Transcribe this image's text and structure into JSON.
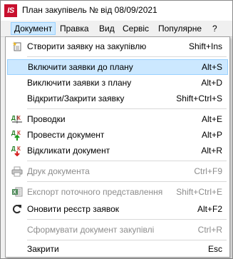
{
  "window": {
    "logo_text": "IS",
    "title": "План закупівель №  від 08/09/2021"
  },
  "menubar": [
    {
      "label": "Документ",
      "active": true
    },
    {
      "label": "Правка"
    },
    {
      "label": "Вид"
    },
    {
      "label": "Сервіс"
    },
    {
      "label": "Популярне"
    },
    {
      "label": "?"
    }
  ],
  "menu": {
    "items": [
      {
        "label": "Створити заявку на закупівлю",
        "shortcut": "Shift+Ins",
        "icon": "new-document-star-icon"
      },
      {
        "label": "Включити заявки до плану",
        "shortcut": "Alt+S",
        "icon": null,
        "highlighted": true
      },
      {
        "label": "Виключити заявки з плану",
        "shortcut": "Alt+D",
        "icon": null
      },
      {
        "label": "Відкрити/Закрити заявку",
        "shortcut": "Shift+Ctrl+S",
        "icon": null
      },
      {
        "label": "Проводки",
        "shortcut": "Alt+E",
        "icon": "dk-postings-icon"
      },
      {
        "label": "Провести документ",
        "shortcut": "Alt+P",
        "icon": "dk-post-up-icon"
      },
      {
        "label": "Відкликати документ",
        "shortcut": "Alt+R",
        "icon": "dk-revoke-down-icon"
      },
      {
        "label": "Друк документа",
        "shortcut": "Ctrl+F9",
        "icon": "printer-icon",
        "disabled": true
      },
      {
        "label": "Експорт поточного представлення",
        "shortcut": "Shift+Ctrl+E",
        "icon": "excel-export-icon",
        "disabled": true
      },
      {
        "label": "Оновити реєстр заявок",
        "shortcut": "Alt+F2",
        "icon": "refresh-icon"
      },
      {
        "label": "Сформувати документ закупівлі",
        "shortcut": "Ctrl+R",
        "icon": null,
        "disabled": true
      },
      {
        "label": "Закрити",
        "shortcut": "Esc",
        "icon": null
      }
    ]
  },
  "colors": {
    "highlight": "#cce8ff",
    "highlight_border": "#99d1ff",
    "disabled_text": "#8d8d8d",
    "logo_red": "#c8102e"
  }
}
